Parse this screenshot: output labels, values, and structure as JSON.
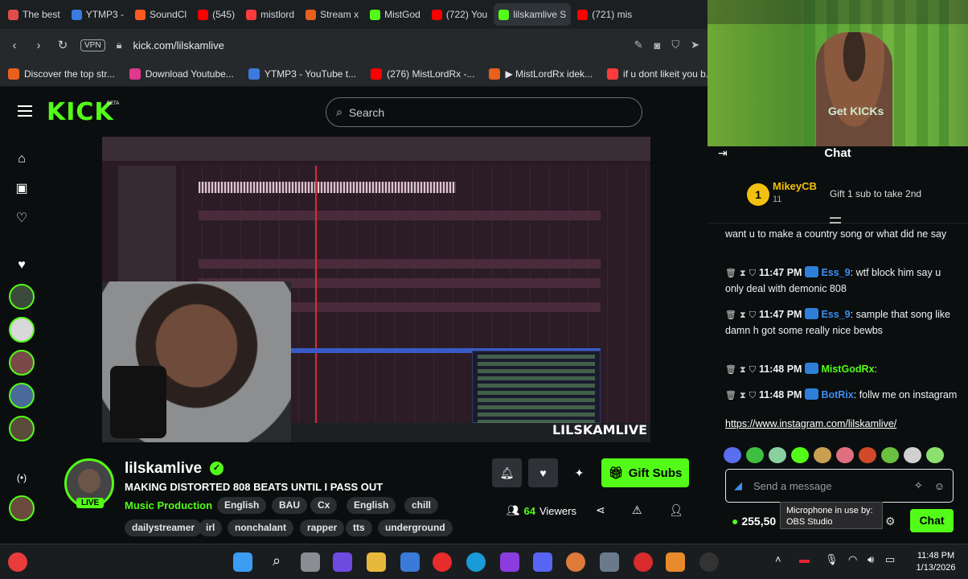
{
  "browser": {
    "tabs": [
      {
        "label": "The best",
        "color": "#e24b4b"
      },
      {
        "label": "YTMP3 -",
        "color": "#3b7be0"
      },
      {
        "label": "SoundCl",
        "color": "#ff5a1f"
      },
      {
        "label": "(545)",
        "color": "#ff0000"
      },
      {
        "label": "mistlord",
        "color": "#ff3b3b"
      },
      {
        "label": "Stream x",
        "color": "#e8601c"
      },
      {
        "label": "MistGod",
        "color": "#53fc18"
      },
      {
        "label": "(722) You",
        "color": "#ff0000"
      },
      {
        "label": "lilskamlive S",
        "color": "#53fc18"
      },
      {
        "label": "(721) mis",
        "color": "#ff0000"
      }
    ],
    "vpn_label": "VPN",
    "url": "kick.com/lilskamlive",
    "bookmarks": [
      {
        "label": "Discover the top str...",
        "color": "#e8601c"
      },
      {
        "label": "Download Youtube...",
        "color": "#e0388f"
      },
      {
        "label": "YTMP3 - YouTube t...",
        "color": "#3b7be0"
      },
      {
        "label": "(276) MistLordRx -...",
        "color": "#ff0000"
      },
      {
        "label": "▶ MistLordRx idek...",
        "color": "#e8601c"
      },
      {
        "label": "if u dont likeit you b...",
        "color": "#ff3b3b"
      }
    ]
  },
  "kick": {
    "logo": "KICK",
    "beta": "BETA",
    "search_placeholder": "Search",
    "stream_watermark": "LILSKAMLIVE",
    "channel": {
      "name": "lilskamlive",
      "live_label": "LIVE",
      "title": "MAKING DISTORTED 808 BEATS UNTIL I PASS OUT",
      "category": "Music Production",
      "tags_row1": [
        "English",
        "BAU",
        "Cx",
        "English",
        "chill"
      ],
      "tags_row2": [
        "dailystreamer",
        "irl",
        "nonchalant",
        "rapper",
        "tts",
        "underground"
      ],
      "viewers_count": "64",
      "viewers_label": "Viewers",
      "gift_label": "Gift Subs"
    }
  },
  "camera": {
    "overlay_text": "Get KICKs"
  },
  "chat": {
    "title": "Chat",
    "pinned": {
      "rank": "1",
      "user": "MikeyCB",
      "count": "11",
      "gift_text": "Gift 1 sub to take 2nd"
    },
    "messages": [
      {
        "time": "",
        "user": "",
        "text": "want u to make a country song or what did ne say",
        "user_color": "#ffffff"
      },
      {
        "time": "11:47 PM",
        "user": "Ess_9",
        "text": "wtf block him say u only deal with demonic 808",
        "user_color": "#3b8ff2"
      },
      {
        "time": "11:47 PM",
        "user": "Ess_9",
        "text": "sample that song like damn h got some really nice bewbs",
        "user_color": "#3b8ff2"
      },
      {
        "time": "11:48 PM",
        "user": "MistGodRx",
        "text": "",
        "user_color": "#53fc18"
      },
      {
        "time": "11:48 PM",
        "user": "BotRix",
        "text": "follw me on instagram",
        "user_color": "#3b8ff2"
      }
    ],
    "link": "https://www.instagram.com/lilskamlive/",
    "input_placeholder": "Send a message",
    "kicks_balance": "255,50",
    "send_label": "Chat",
    "tooltip_line1": "Microphone in use by:",
    "tooltip_line2": "OBS Studio"
  },
  "taskbar": {
    "time": "11:48 PM",
    "date": "1/13/2026"
  }
}
